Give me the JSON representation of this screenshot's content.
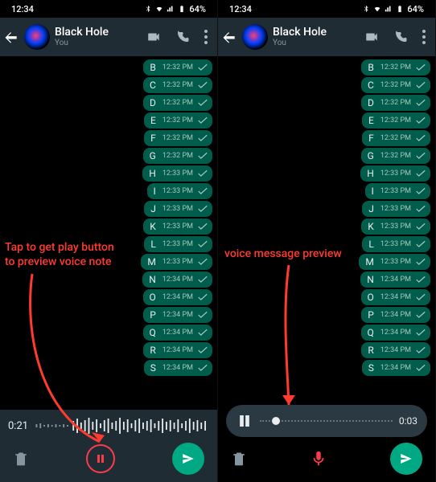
{
  "status": {
    "time": "12:34",
    "battery": "64%"
  },
  "header": {
    "name": "Black Hole",
    "sub": "You"
  },
  "messages": [
    {
      "letter": "B",
      "time": "12:32 PM"
    },
    {
      "letter": "C",
      "time": "12:32 PM"
    },
    {
      "letter": "D",
      "time": "12:32 PM"
    },
    {
      "letter": "E",
      "time": "12:32 PM"
    },
    {
      "letter": "F",
      "time": "12:32 PM"
    },
    {
      "letter": "G",
      "time": "12:32 PM"
    },
    {
      "letter": "H",
      "time": "12:33 PM"
    },
    {
      "letter": "I",
      "time": "12:33 PM"
    },
    {
      "letter": "J",
      "time": "12:33 PM"
    },
    {
      "letter": "K",
      "time": "12:33 PM"
    },
    {
      "letter": "L",
      "time": "12:33 PM"
    },
    {
      "letter": "M",
      "time": "12:33 PM"
    },
    {
      "letter": "N",
      "time": "12:34 PM"
    },
    {
      "letter": "O",
      "time": "12:34 PM"
    },
    {
      "letter": "P",
      "time": "12:34 PM"
    },
    {
      "letter": "Q",
      "time": "12:34 PM"
    },
    {
      "letter": "R",
      "time": "12:34 PM"
    },
    {
      "letter": "S",
      "time": "12:34 PM"
    }
  ],
  "left": {
    "rec_timer": "0:21",
    "annotation": "Tap to get play button\nto preview voice note"
  },
  "right": {
    "preview_time": "0:03",
    "annotation": "voice message preview"
  }
}
